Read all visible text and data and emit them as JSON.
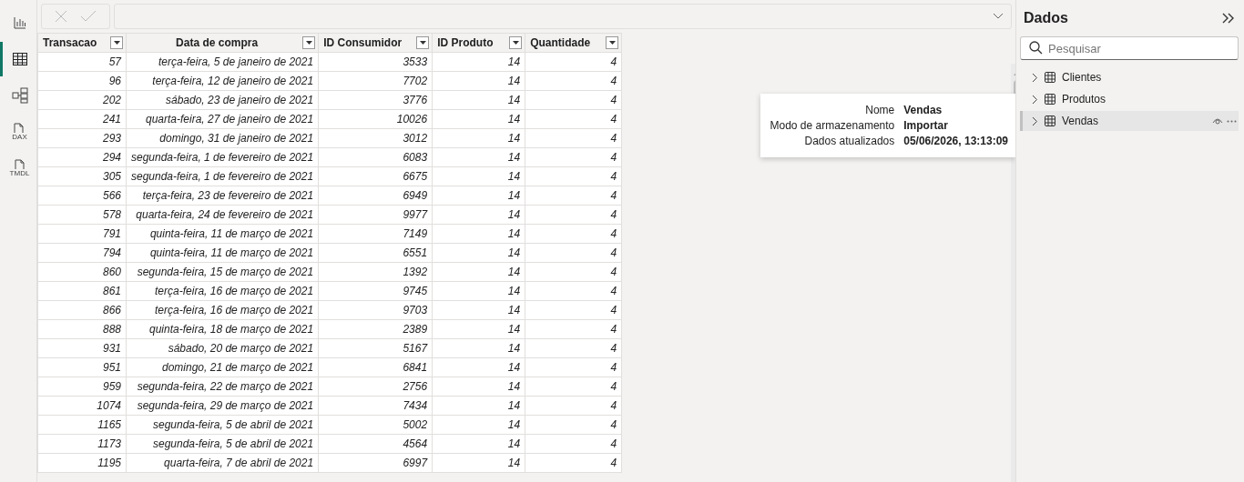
{
  "rail": [
    {
      "kind": "report",
      "selected": false
    },
    {
      "kind": "table",
      "selected": true
    },
    {
      "kind": "model",
      "selected": false
    },
    {
      "kind": "query",
      "label": "DAX",
      "selected": false
    },
    {
      "kind": "query",
      "label": "TMDL",
      "selected": false
    }
  ],
  "table": {
    "columns": [
      "Transacao",
      "Data de compra",
      "ID Consumidor",
      "ID Produto",
      "Quantidade"
    ],
    "rows": [
      [
        "57",
        "terça-feira, 5 de janeiro de 2021",
        "3533",
        "14",
        "4"
      ],
      [
        "96",
        "terça-feira, 12 de janeiro de 2021",
        "7702",
        "14",
        "4"
      ],
      [
        "202",
        "sábado, 23 de janeiro de 2021",
        "3776",
        "14",
        "4"
      ],
      [
        "241",
        "quarta-feira, 27 de janeiro de 2021",
        "10026",
        "14",
        "4"
      ],
      [
        "293",
        "domingo, 31 de janeiro de 2021",
        "3012",
        "14",
        "4"
      ],
      [
        "294",
        "segunda-feira, 1 de fevereiro de 2021",
        "6083",
        "14",
        "4"
      ],
      [
        "305",
        "segunda-feira, 1 de fevereiro de 2021",
        "6675",
        "14",
        "4"
      ],
      [
        "566",
        "terça-feira, 23 de fevereiro de 2021",
        "6949",
        "14",
        "4"
      ],
      [
        "578",
        "quarta-feira, 24 de fevereiro de 2021",
        "9977",
        "14",
        "4"
      ],
      [
        "791",
        "quinta-feira, 11 de março de 2021",
        "7149",
        "14",
        "4"
      ],
      [
        "794",
        "quinta-feira, 11 de março de 2021",
        "6551",
        "14",
        "4"
      ],
      [
        "860",
        "segunda-feira, 15 de março de 2021",
        "1392",
        "14",
        "4"
      ],
      [
        "861",
        "terça-feira, 16 de março de 2021",
        "9745",
        "14",
        "4"
      ],
      [
        "866",
        "terça-feira, 16 de março de 2021",
        "9703",
        "14",
        "4"
      ],
      [
        "888",
        "quinta-feira, 18 de março de 2021",
        "2389",
        "14",
        "4"
      ],
      [
        "931",
        "sábado, 20 de março de 2021",
        "5167",
        "14",
        "4"
      ],
      [
        "951",
        "domingo, 21 de março de 2021",
        "6841",
        "14",
        "4"
      ],
      [
        "959",
        "segunda-feira, 22 de março de 2021",
        "2756",
        "14",
        "4"
      ],
      [
        "1074",
        "segunda-feira, 29 de março de 2021",
        "7434",
        "14",
        "4"
      ],
      [
        "1165",
        "segunda-feira, 5 de abril de 2021",
        "5002",
        "14",
        "4"
      ],
      [
        "1173",
        "segunda-feira, 5 de abril de 2021",
        "4564",
        "14",
        "4"
      ],
      [
        "1195",
        "quarta-feira, 7 de abril de 2021",
        "6997",
        "14",
        "4"
      ]
    ]
  },
  "tooltip": [
    {
      "label": "Nome",
      "value": "Vendas"
    },
    {
      "label": "Modo de armazenamento",
      "value": "Importar"
    },
    {
      "label": "Dados atualizados",
      "value": "05/06/2026, 13:13:09"
    }
  ],
  "data_pane": {
    "title": "Dados",
    "search": {
      "placeholder": "Pesquisar"
    },
    "items": [
      {
        "label": "Clientes",
        "selected": false
      },
      {
        "label": "Produtos",
        "selected": false
      },
      {
        "label": "Vendas",
        "selected": true
      }
    ]
  }
}
